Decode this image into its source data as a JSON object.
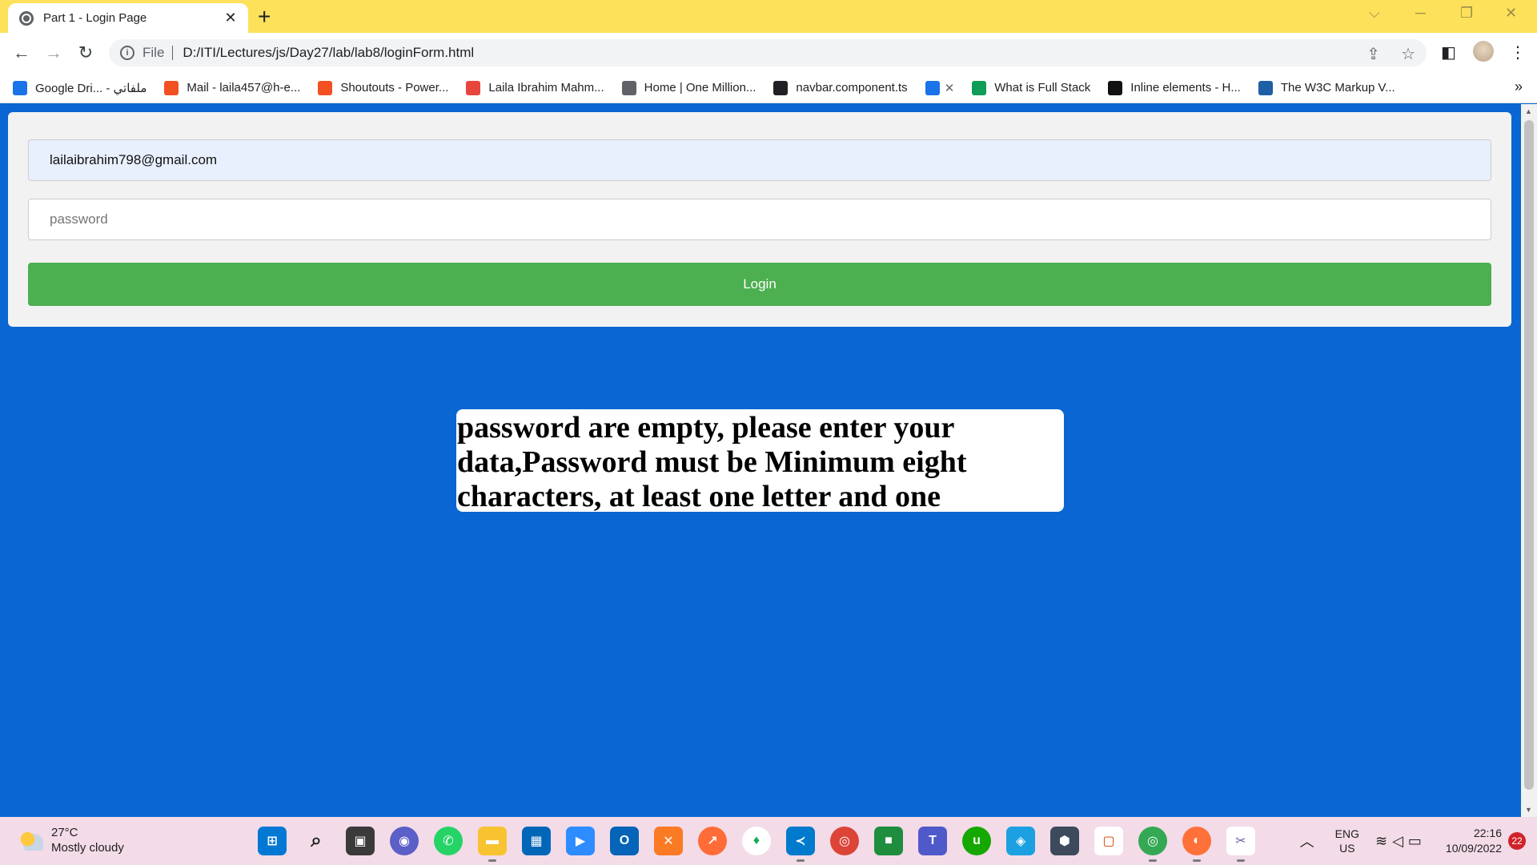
{
  "browser": {
    "tab_title": "Part 1 - Login Page",
    "url_scheme": "File",
    "url": "D:/ITI/Lectures/js/Day27/lab/lab8/loginForm.html",
    "bookmarks": [
      {
        "label": "Google Dri... - ملفاتي",
        "color": "#1a73e8"
      },
      {
        "label": "Mail - laila457@h-e...",
        "color": "#f25022"
      },
      {
        "label": "Shoutouts - Power...",
        "color": "#f25022"
      },
      {
        "label": "Laila Ibrahim Mahm...",
        "color": "#e8453c"
      },
      {
        "label": "Home | One Million...",
        "color": "#5f6368"
      },
      {
        "label": "navbar.component.ts",
        "color": "#202124"
      },
      {
        "label": "",
        "color": "#1a73e8"
      },
      {
        "label": "What is Full Stack",
        "color": "#0f9d58"
      },
      {
        "label": "Inline elements - H...",
        "color": "#111111"
      },
      {
        "label": "The W3C Markup V...",
        "color": "#1f5fa6"
      }
    ]
  },
  "login": {
    "email_value": "lailaibrahim798@gmail.com",
    "password_placeholder": "password",
    "button_label": "Login"
  },
  "error": {
    "message": "password are empty, please enter your data,Password must be Minimum eight characters, at least one letter and one number:"
  },
  "taskbar": {
    "temperature": "27°C",
    "weather": "Mostly cloudy",
    "lang_top": "ENG",
    "lang_bottom": "US",
    "time": "22:16",
    "date": "10/09/2022",
    "notifications": "22"
  },
  "colors": {
    "page_background": "#0a66d2",
    "login_button": "#4caf50",
    "tab_bar": "#fde15a"
  }
}
